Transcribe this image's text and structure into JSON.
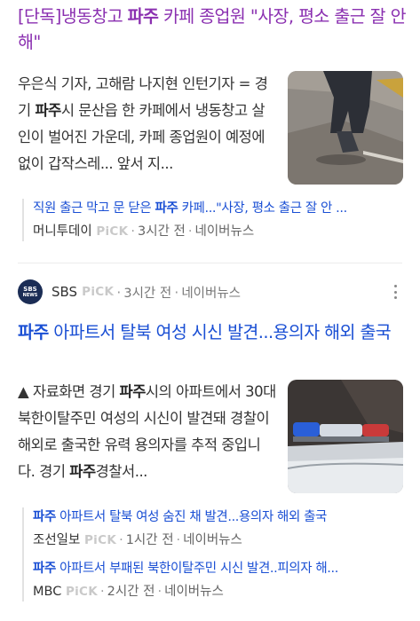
{
  "article1": {
    "headline_pre": "[단독]냉동창고 ",
    "headline_kw": "파주",
    "headline_post": " 카페 종업원 \"사장, 평소 출근 잘 안해\"",
    "snippet_pre": "우은식 기자, 고해람 나지현 인턴기자 = 경기 ",
    "snippet_kw": "파주",
    "snippet_post": "시 문산읍 한 카페에서 냉동창고 살인이 벌어진 가운데, 카페 종업원이 예정에 없이 갑작스레... 앞서 지...",
    "related": [
      {
        "title_pre": "직원 출근 막고 문 닫은 ",
        "title_kw": "파주",
        "title_post": " 카페...\"사장, 평소 출근 잘 안 ...",
        "press": "머니투데이",
        "pick": "PiCK",
        "time": "3시간 전",
        "source": "네이버뉴스"
      }
    ]
  },
  "article2": {
    "logo_top": "SBS",
    "logo_bottom": "NEWS",
    "press": "SBS",
    "pick": "PiCK",
    "time": "3시간 전",
    "source": "네이버뉴스",
    "headline_kw": "파주",
    "headline_post": " 아파트서 탈북 여성 시신 발견...용의자 해외 출국",
    "snippet_pre": "▲ 자료화면 경기 ",
    "snippet_kw": "파주",
    "snippet_mid": "시의 아파트에서 30대 북한이탈주민 여성의 시신이 발견돼 경찰이 해외로 출국한 유력 용의자를 추적 중입니다. 경기 ",
    "snippet_kw2": "파주",
    "snippet_post": "경찰서...",
    "related": [
      {
        "title_kw": "파주",
        "title_post": " 아파트서 탈북 여성 숨진 채 발견...용의자 해외 출국",
        "press": "조선일보",
        "pick": "PiCK",
        "time": "1시간 전",
        "source": "네이버뉴스"
      },
      {
        "title_kw": "파주",
        "title_post": " 아파트서 부패된 북한이탈주민 시신 발견..피의자 해...",
        "press": "MBC",
        "pick": "PiCK",
        "time": "2시간 전",
        "source": "네이버뉴스"
      }
    ]
  },
  "colors": {
    "visited_headline": "#8a2fb0",
    "headline": "#1a4fd4",
    "pick": "#c9c9c9"
  },
  "icons": [
    "more-vertical-icon",
    "sbs-news-logo"
  ]
}
